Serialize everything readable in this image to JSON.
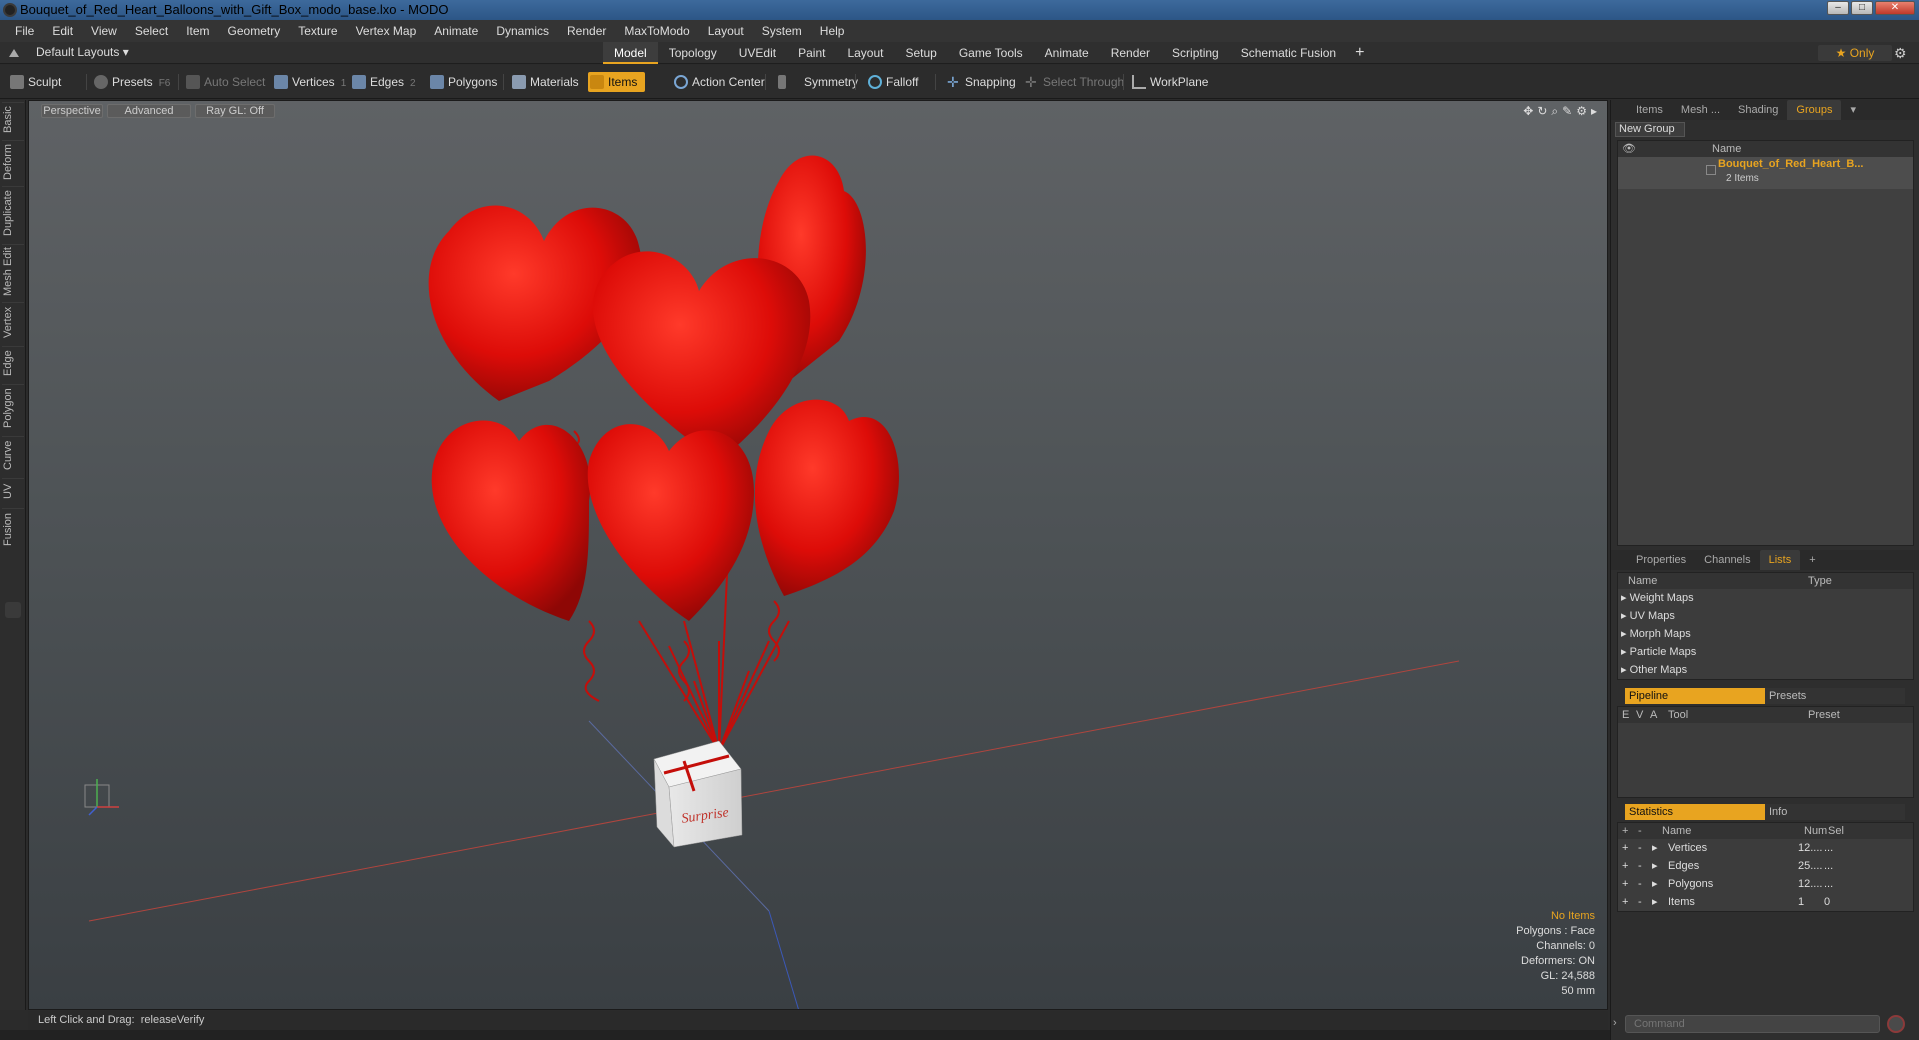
{
  "window": {
    "title": "Bouquet_of_Red_Heart_Balloons_with_Gift_Box_modo_base.lxo - MODO"
  },
  "menu": [
    "File",
    "Edit",
    "View",
    "Select",
    "Item",
    "Geometry",
    "Texture",
    "Vertex Map",
    "Animate",
    "Dynamics",
    "Render",
    "MaxToModo",
    "Layout",
    "System",
    "Help"
  ],
  "layout": {
    "dropdown": "Default Layouts",
    "only_label": "Only"
  },
  "tabs": [
    "Model",
    "Topology",
    "UVEdit",
    "Paint",
    "Layout",
    "Setup",
    "Game Tools",
    "Animate",
    "Render",
    "Scripting",
    "Schematic Fusion"
  ],
  "active_tab": "Model",
  "toolbar": {
    "sculpt": "Sculpt",
    "presets": "Presets",
    "presets_key": "F6",
    "auto_select": "Auto Select",
    "vertices": "Vertices",
    "vertices_count": "1",
    "edges": "Edges",
    "edges_count": "2",
    "polygons": "Polygons",
    "materials": "Materials",
    "items": "Items",
    "action_center": "Action Center",
    "symmetry": "Symmetry",
    "falloff": "Falloff",
    "snapping": "Snapping",
    "select_through": "Select Through",
    "workplane": "WorkPlane"
  },
  "left_tabs": [
    "Basic",
    "Deform",
    "Duplicate",
    "Mesh Edit",
    "Vertex",
    "Edge",
    "Polygon",
    "Curve",
    "UV",
    "Fusion"
  ],
  "viewport": {
    "view_mode": "Perspective",
    "shading": "Advanced",
    "raygl": "Ray GL: Off",
    "box_label": "Surprise",
    "stats": {
      "selection": "No Items",
      "polygons": "Polygons : Face",
      "channels": "Channels: 0",
      "deformers": "Deformers: ON",
      "gl": "GL: 24,588",
      "lens": "50 mm"
    }
  },
  "status": {
    "hint": "Left Click and Drag:",
    "action": "releaseVerify"
  },
  "right_panel": {
    "top_tabs": [
      "Items",
      "Mesh ...",
      "Shading",
      "Groups"
    ],
    "top_active": "Groups",
    "new_group": "New Group",
    "name_header": "Name",
    "group_name": "Bouquet_of_Red_Heart_B...",
    "group_count": "2 Items",
    "mid_tabs": [
      "Properties",
      "Channels",
      "Lists"
    ],
    "mid_active": "Lists",
    "lists_headers": {
      "name": "Name",
      "type": "Type"
    },
    "lists_items": [
      "Weight Maps",
      "UV Maps",
      "Morph Maps",
      "Particle Maps",
      "Other Maps"
    ],
    "pipeline_tab": "Pipeline",
    "presets_tab": "Presets",
    "pipeline_headers": {
      "e": "E",
      "v": "V",
      "a": "A",
      "tool": "Tool",
      "preset": "Preset"
    },
    "statistics_tab": "Statistics",
    "info_tab": "Info",
    "stats_headers": {
      "name": "Name",
      "num": "Num",
      "sel": "Sel"
    },
    "stats_rows": [
      {
        "name": "Vertices",
        "num": "12....",
        "sel": "..."
      },
      {
        "name": "Edges",
        "num": "25....",
        "sel": "..."
      },
      {
        "name": "Polygons",
        "num": "12....",
        "sel": "..."
      },
      {
        "name": "Items",
        "num": "1",
        "sel": "0"
      }
    ],
    "command_placeholder": "Command"
  },
  "colors": {
    "accent": "#e8a420",
    "balloon": "#e4130f",
    "viewport_top": "#5f6265",
    "viewport_bottom": "#3a3f43"
  }
}
